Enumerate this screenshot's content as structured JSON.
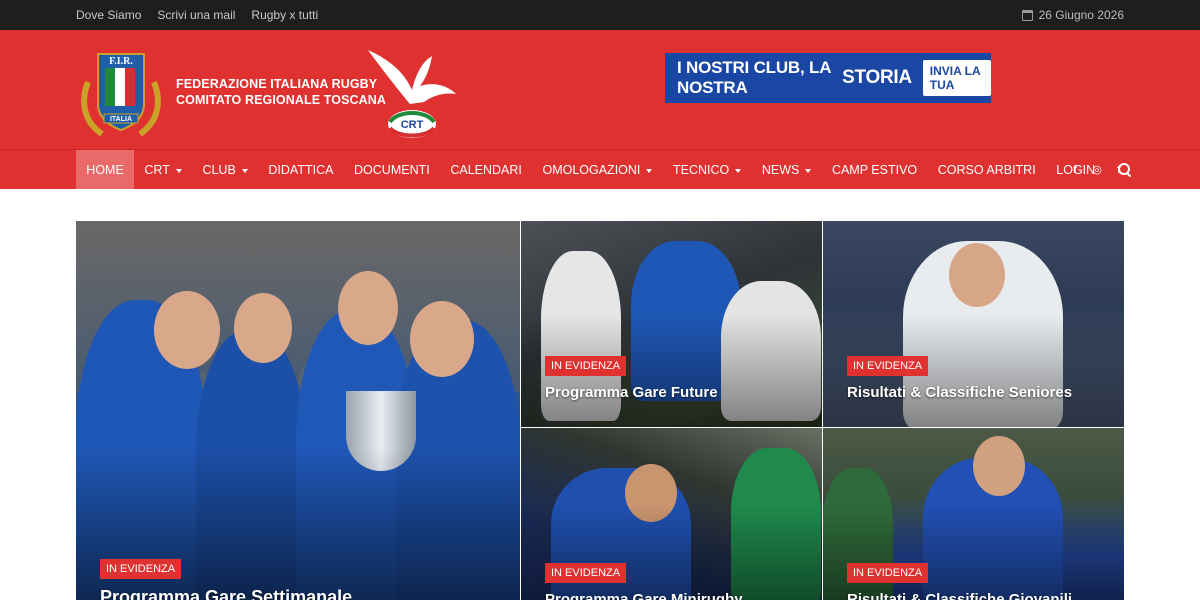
{
  "topbar": {
    "links": [
      "Dove Siamo",
      "Scrivi una mail",
      "Rugby x tutti"
    ],
    "date": "26 Giugno 2026"
  },
  "header": {
    "fir_logo_text": "F.I.R.",
    "fir_logo_caption": "ITALIA",
    "federation_line1": "FEDERAZIONE ITALIANA RUGBY",
    "federation_line2": "COMITATO REGIONALE TOSCANA",
    "crt_logo_text": "CRT",
    "banner": {
      "text_part1": "I NOSTRI CLUB, LA NOSTRA",
      "text_part2": "STORIA",
      "button": "INVIA LA TUA"
    }
  },
  "nav": {
    "items": [
      {
        "label": "HOME",
        "dropdown": false,
        "active": true
      },
      {
        "label": "CRT",
        "dropdown": true
      },
      {
        "label": "CLUB",
        "dropdown": true
      },
      {
        "label": "DIDATTICA",
        "dropdown": false
      },
      {
        "label": "DOCUMENTI",
        "dropdown": false
      },
      {
        "label": "CALENDARI",
        "dropdown": false
      },
      {
        "label": "OMOLOGAZIONI",
        "dropdown": true
      },
      {
        "label": "TECNICO",
        "dropdown": true
      },
      {
        "label": "NEWS",
        "dropdown": true
      },
      {
        "label": "CAMP ESTIVO",
        "dropdown": false
      },
      {
        "label": "CORSO ARBITRI",
        "dropdown": false
      },
      {
        "label": "LOGIN",
        "dropdown": false
      }
    ],
    "search_icon": "search-icon",
    "social": [
      {
        "icon": "facebook-icon",
        "glyph": "f"
      },
      {
        "icon": "instagram-icon",
        "glyph": "◎"
      },
      {
        "icon": "twitter-icon",
        "glyph": "t"
      }
    ]
  },
  "featured": [
    {
      "badge": "IN EVIDENZA",
      "title": "Programma Gare Settimanale"
    },
    {
      "badge": "IN EVIDENZA",
      "title": "Programma Gare Future"
    },
    {
      "badge": "IN EVIDENZA",
      "title": "Risultati & Classifiche Seniores"
    },
    {
      "badge": "IN EVIDENZA",
      "title": "Programma Gare Minirugby"
    },
    {
      "badge": "IN EVIDENZA",
      "title": "Risultati & Classifiche Giovanili"
    }
  ],
  "colors": {
    "brand_red": "#e03131",
    "topbar_bg": "#1e1e1e",
    "banner_blue": "#1a47a3"
  }
}
